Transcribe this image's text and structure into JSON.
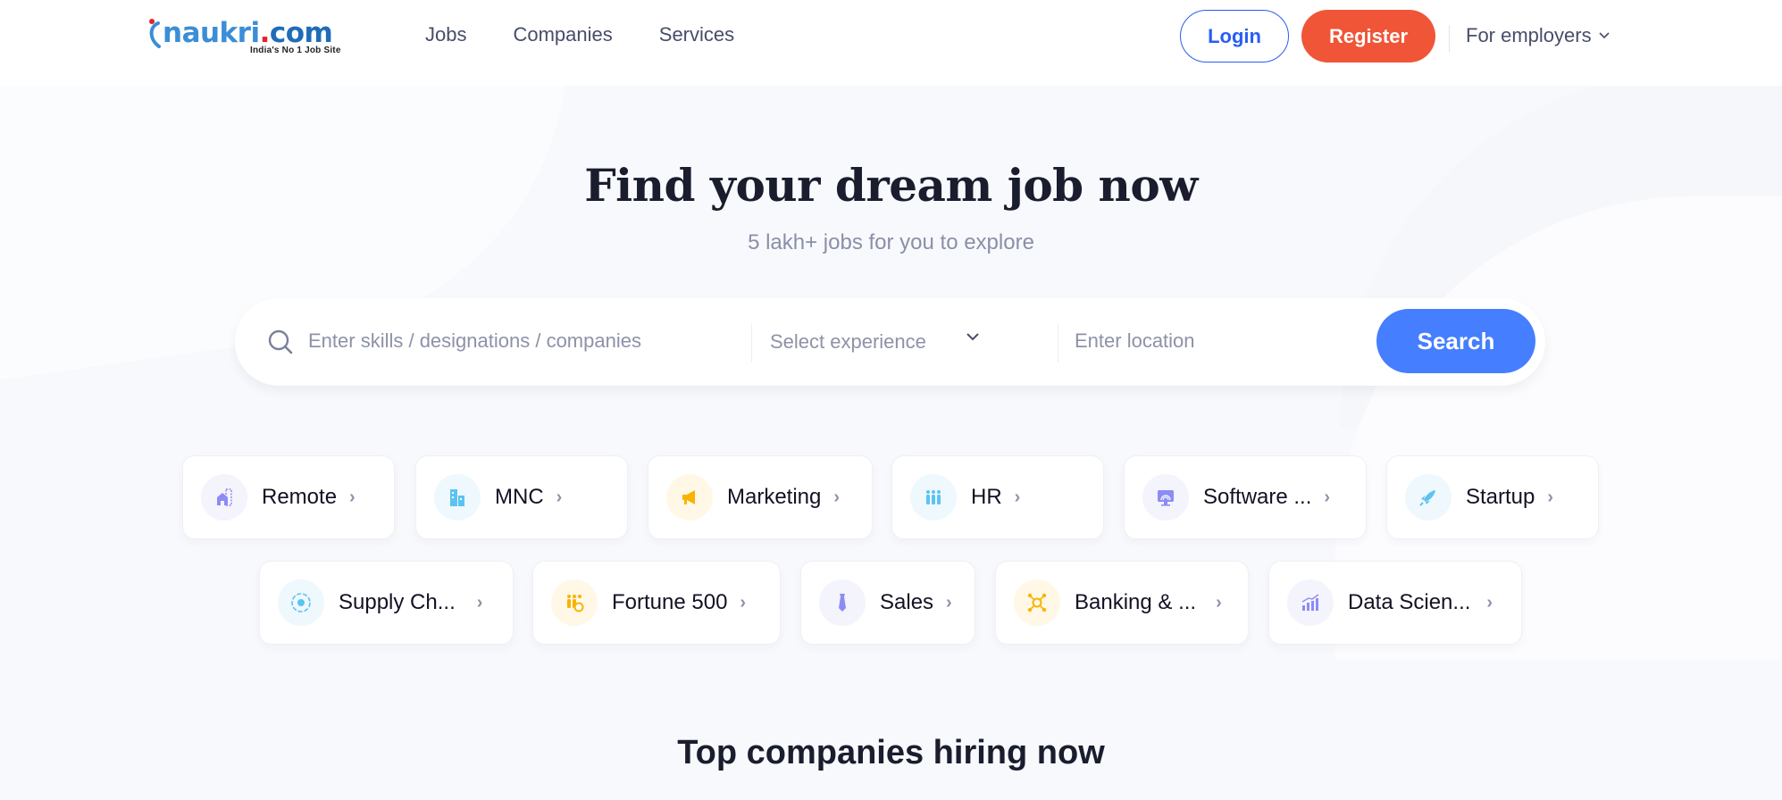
{
  "header": {
    "logo": {
      "brand_main": "naukri",
      "brand_dot": ".",
      "brand_tld": "com",
      "tagline": "India's No 1 Job Site"
    },
    "nav": [
      {
        "label": "Jobs"
      },
      {
        "label": "Companies"
      },
      {
        "label": "Services"
      }
    ],
    "login_label": "Login",
    "register_label": "Register",
    "employers_label": "For employers"
  },
  "hero": {
    "title": "Find your dream job now",
    "subtitle": "5 lakh+ jobs for you to explore"
  },
  "search": {
    "skills_placeholder": "Enter skills / designations / companies",
    "skills_value": "",
    "experience_placeholder": "Select experience",
    "location_placeholder": "Enter location",
    "location_value": "",
    "button_label": "Search"
  },
  "categories": [
    {
      "label": "Remote",
      "icon": "remote-home-icon",
      "color": "#8c8cf5",
      "bg": "#f4f4fd"
    },
    {
      "label": "MNC",
      "icon": "buildings-icon",
      "color": "#5cc3f0",
      "bg": "#eef8fd"
    },
    {
      "label": "Marketing",
      "icon": "megaphone-icon",
      "color": "#f8b400",
      "bg": "#fff8e6"
    },
    {
      "label": "HR",
      "icon": "people-icon",
      "color": "#5cc3f0",
      "bg": "#eef8fd"
    },
    {
      "label": "Software ...",
      "icon": "monitor-icon",
      "color": "#8c8cf5",
      "bg": "#f4f4fd"
    },
    {
      "label": "Startup",
      "icon": "rocket-icon",
      "color": "#5cc3f0",
      "bg": "#eef8fd"
    },
    {
      "label": "Supply Ch...",
      "icon": "supply-chain-icon",
      "color": "#5cc3f0",
      "bg": "#eef8fd"
    },
    {
      "label": "Fortune 500",
      "icon": "group-coin-icon",
      "color": "#f8b400",
      "bg": "#fff8e6"
    },
    {
      "label": "Sales",
      "icon": "tie-icon",
      "color": "#8c8cf5",
      "bg": "#f4f4fd"
    },
    {
      "label": "Banking & ...",
      "icon": "network-coin-icon",
      "color": "#f8b400",
      "bg": "#fff8e6"
    },
    {
      "label": "Data Scien...",
      "icon": "bar-chart-icon",
      "color": "#8c8cf5",
      "bg": "#f4f4fd"
    }
  ],
  "section": {
    "top_companies_heading": "Top companies hiring now"
  }
}
